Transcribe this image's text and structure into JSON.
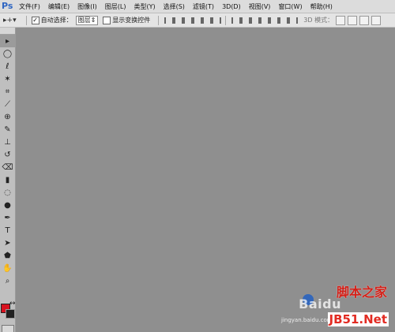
{
  "app": {
    "logo": "Ps"
  },
  "menu": [
    "文件(F)",
    "编辑(E)",
    "图像(I)",
    "图层(L)",
    "类型(Y)",
    "选择(S)",
    "滤镜(T)",
    "3D(D)",
    "视图(V)",
    "窗口(W)",
    "帮助(H)"
  ],
  "options": {
    "auto_select_label": "自动选择：",
    "auto_select_value": "图层",
    "show_transform_label": "显示变换控件",
    "mode_3d_label": "3D 模式："
  },
  "tools": [
    "move-tool",
    "marquee-tool",
    "lasso-tool",
    "quick-selection-tool",
    "crop-tool",
    "eyedropper-tool",
    "healing-brush-tool",
    "brush-tool",
    "clone-stamp-tool",
    "history-brush-tool",
    "eraser-tool",
    "gradient-tool",
    "blur-tool",
    "dodge-tool",
    "pen-tool",
    "type-tool",
    "path-selection-tool",
    "shape-tool",
    "hand-tool",
    "zoom-tool"
  ],
  "colors": {
    "foreground": "#d7121f",
    "background": "#222222"
  },
  "watermark": {
    "brand_latin": "Bai",
    "brand_mark": "du",
    "site_cn": "脚本之家",
    "url": "jingyan.baidu.com",
    "site_en": "JB51.Net"
  }
}
